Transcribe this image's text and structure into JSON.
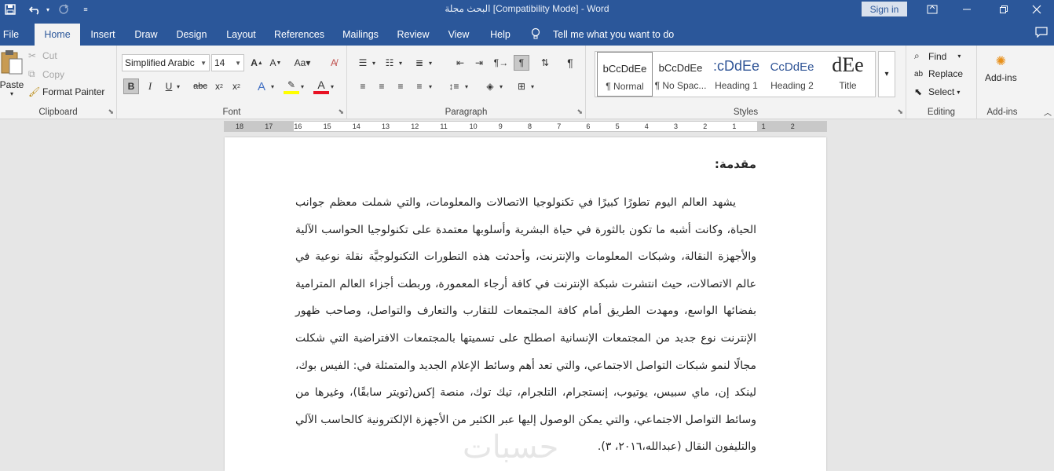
{
  "window": {
    "title": "البحث مجلة [Compatibility Mode]  -  Word",
    "signin_label": "Sign in"
  },
  "quick_access": {
    "icons": [
      "save-icon",
      "undo-icon",
      "redo-icon",
      "customize-icon"
    ]
  },
  "tabs": [
    {
      "label": "File"
    },
    {
      "label": "Home"
    },
    {
      "label": "Insert"
    },
    {
      "label": "Draw"
    },
    {
      "label": "Design"
    },
    {
      "label": "Layout"
    },
    {
      "label": "References"
    },
    {
      "label": "Mailings"
    },
    {
      "label": "Review"
    },
    {
      "label": "View"
    },
    {
      "label": "Help"
    }
  ],
  "active_tab": "Home",
  "tellme": "Tell me what you want to do",
  "clipboard": {
    "label": "Clipboard",
    "paste": "Paste",
    "cut": "Cut",
    "copy": "Copy",
    "format_painter": "Format Painter"
  },
  "font": {
    "label": "Font",
    "name": "Simplified Arabic",
    "size": "14"
  },
  "paragraph": {
    "label": "Paragraph"
  },
  "styles": {
    "label": "Styles",
    "items": [
      {
        "preview": "bCcDdEe",
        "name": "¶ Normal"
      },
      {
        "preview": "bCcDdEe",
        "name": "¶ No Spac..."
      },
      {
        "preview": ":cDdEe",
        "name": "Heading 1"
      },
      {
        "preview": "CcDdEe",
        "name": "Heading 2"
      },
      {
        "preview": "dEe",
        "name": "Title"
      }
    ]
  },
  "editing": {
    "label": "Editing",
    "find": "Find",
    "replace": "Replace",
    "select": "Select"
  },
  "addins": {
    "label": "Add-ins",
    "button": "Add-ins"
  },
  "ruler": {
    "ticks": [
      "18",
      "17",
      "16",
      "15",
      "14",
      "13",
      "12",
      "11",
      "10",
      "9",
      "8",
      "7",
      "6",
      "5",
      "4",
      "3",
      "2",
      "1",
      "1",
      "2"
    ]
  },
  "document": {
    "heading": "مقدمة:",
    "paragraph": "يشهد العالم اليوم تطورًا كبيرًا في تكنولوجيا الاتصالات والمعلومات، والتي شملت معظم جوانب الحياة، وكانت أشبه ما تكون بالثورة في حياة البشرية وأسلوبها معتمدة على تكنولوجيا الحواسب الآلية والأجهزة النقالة، وشبكات المعلومات والإنترنت، وأحدثت هذه التطورات التكنولوجيَّة نقلة نوعية في عالم الاتصالات، حيث انتشرت شبكة الإنترنت في كافة أرجاء المعمورة، وربطت أجزاء العالم المترامية بفضائها الواسع، ومهدت الطريق أمام كافة المجتمعات للتقارب والتعارف والتواصل، وصاحب ظهور الإنترنت نوع جديد من المجتمعات الإنسانية اصطلح على تسميتها بالمجتمعات الافتراضية التي شكلت مجالًا لنمو شبكات التواصل الاجتماعي، والتي تعد أهم وسائط الإعلام الجديد والمتمثلة في: الفيس بوك، لينكد إن، ماي سبيس، يوتيوب، إنستجرام، التلجرام، تيك توك، منصة إكس(تويتر سابقًا)، وغيرها من وسائط التواصل الاجتماعي، والتي يمكن الوصول إليها عبر الكثير من الأجهزة الإلكترونية كالحاسب الآلي والتليفون النقال (عبدالله،٢٠١٦، ٣).",
    "watermark": "حسبات"
  }
}
